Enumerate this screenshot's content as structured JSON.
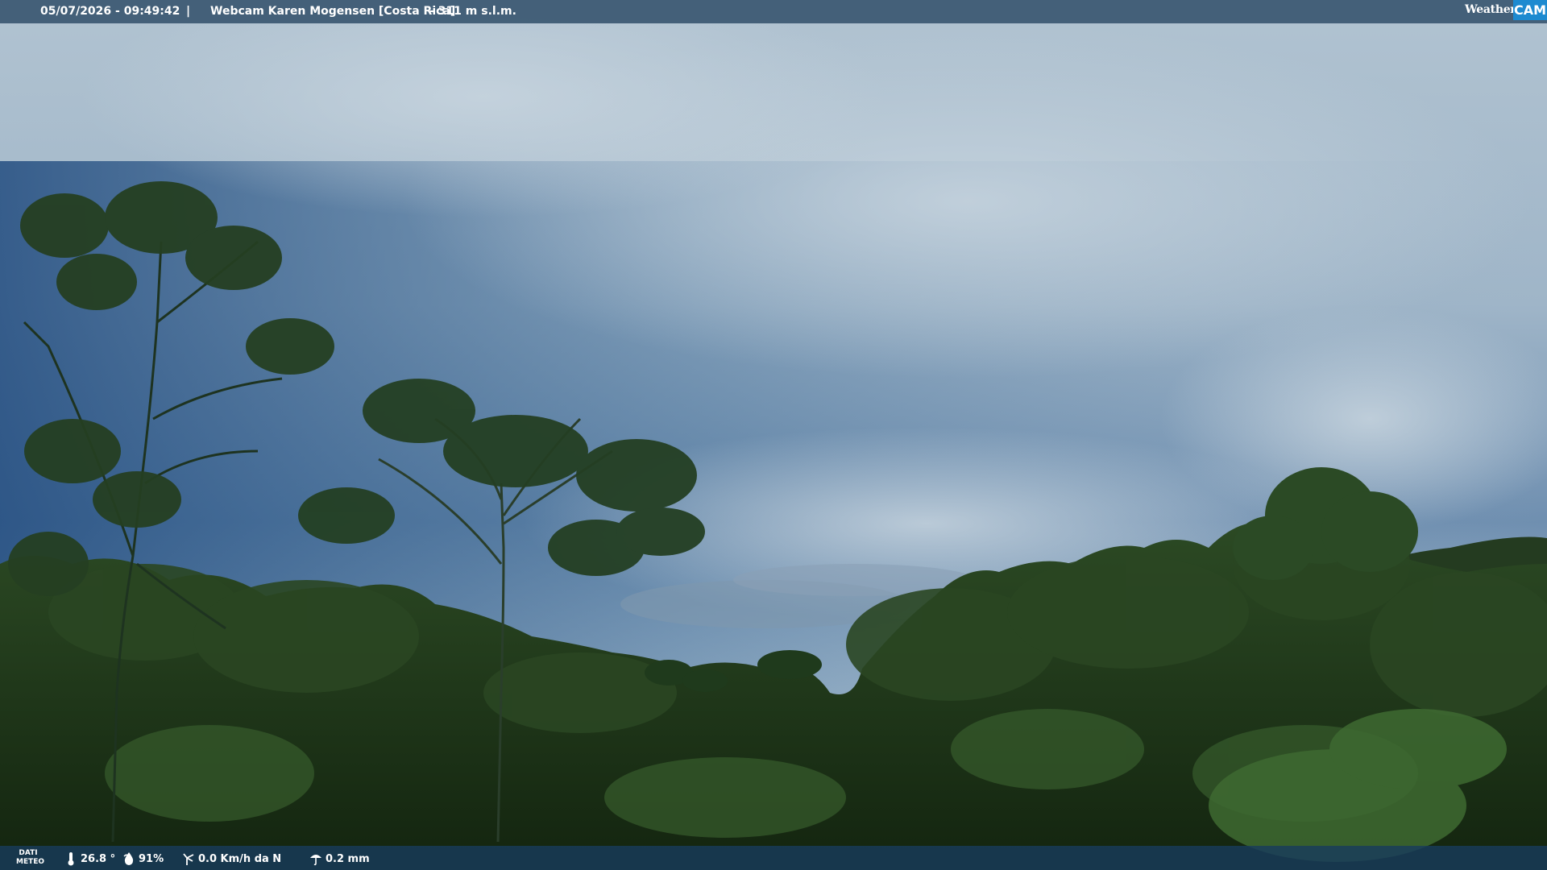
{
  "header": {
    "datetime": "05/07/2026 - 09:49:42",
    "separator": "|",
    "title": "Webcam Karen Mogensen [Costa Rica]",
    "altitude": "- 311 m s.l.m."
  },
  "logo": {
    "weather_text": "Weather",
    "cam_text": "CAM"
  },
  "footer": {
    "label": "DATI METEO",
    "temperature": "26.8 °",
    "humidity": "91%",
    "wind": "0.0 Km/h da N",
    "rain": "0.2 mm",
    "icons": [
      "thermometer-icon",
      "humidity-icon",
      "wind-icon",
      "rain-icon"
    ]
  },
  "colors": {
    "sky_top": "#a9bccb",
    "sky_left": "#2f5c8a",
    "foliage": "#1c3418",
    "bar": "#34526c",
    "cam_badge": "#1d8ad0"
  }
}
